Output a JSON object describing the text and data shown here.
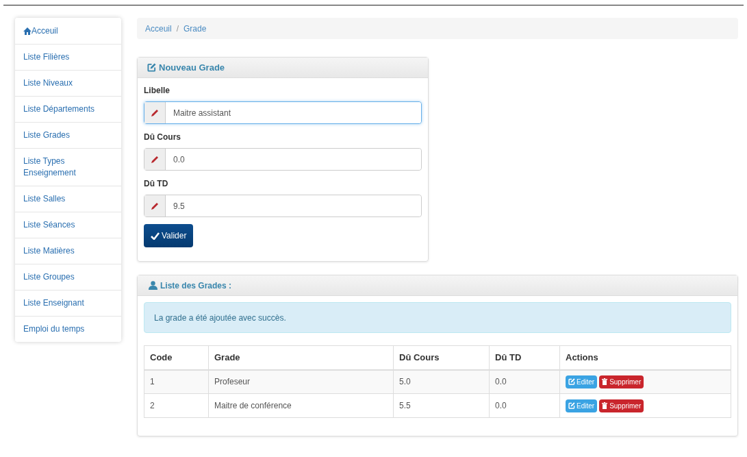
{
  "sidebar": {
    "items": [
      {
        "label": "Acceuil",
        "kind": "home"
      },
      {
        "label": "Liste Filières",
        "kind": "link"
      },
      {
        "label": "Liste Niveaux",
        "kind": "link"
      },
      {
        "label": "Liste Départements",
        "kind": "link"
      },
      {
        "label": "Liste Grades",
        "kind": "link"
      },
      {
        "label": "Liste Types Enseignement",
        "kind": "link"
      },
      {
        "label": "Liste Salles",
        "kind": "link"
      },
      {
        "label": "Liste Séances",
        "kind": "link"
      },
      {
        "label": "Liste Matières",
        "kind": "link"
      },
      {
        "label": "Liste Groupes",
        "kind": "link"
      },
      {
        "label": "Liste Enseignant",
        "kind": "link"
      },
      {
        "label": "Emploi du temps",
        "kind": "link"
      }
    ]
  },
  "breadcrumb": {
    "separator": "/",
    "items": [
      "Acceuil",
      "Grade"
    ]
  },
  "form": {
    "title": "Nouveau Grade",
    "fields": [
      {
        "label": "Libelle",
        "value": "Maitre assistant",
        "focused": true
      },
      {
        "label": "Dû Cours",
        "value": "0.0",
        "focused": false
      },
      {
        "label": "Dû TD",
        "value": "9.5",
        "focused": false
      }
    ],
    "submit": "Valider"
  },
  "list": {
    "title": "Liste des Grades :",
    "alert": "La grade a été ajoutée avec succès.",
    "table": {
      "columns": [
        "Code",
        "Grade",
        "Dû Cours",
        "Dû TD",
        "Actions"
      ],
      "rows": [
        {
          "cells": [
            "1",
            "Profeseur",
            "5.0",
            "0.0"
          ],
          "edit": "Editer",
          "delete": "Supprimer"
        },
        {
          "cells": [
            "2",
            "Maitre de conférence",
            "5.5",
            "0.0"
          ],
          "edit": "Editer",
          "delete": "Supprimer"
        }
      ]
    }
  }
}
